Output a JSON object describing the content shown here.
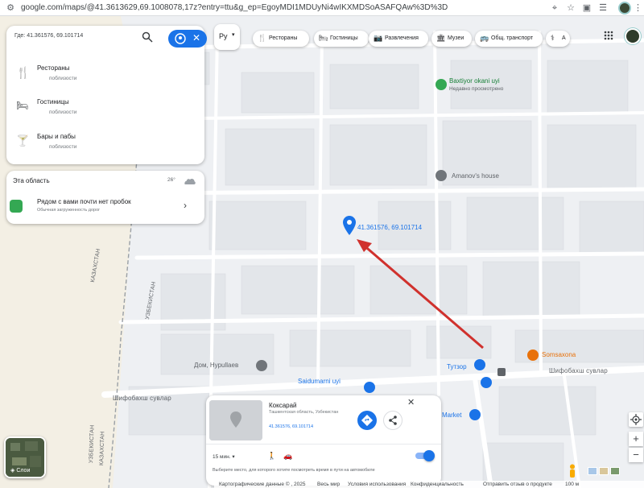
{
  "browser": {
    "url": "google.com/maps/@41.3613629,69.1008078,17z?entry=ttu&g_ep=EgoyMDI1MDUyNi4wIKXMDSoASAFQAw%3D%3D"
  },
  "search": {
    "value": "Где: 41.361576, 69.101714",
    "nearby": [
      {
        "title": "Рестораны",
        "subtitle": "поблизости",
        "icon": "restaurant-icon"
      },
      {
        "title": "Гостиницы",
        "subtitle": "поблизости",
        "icon": "hotel-icon"
      },
      {
        "title": "Бары и пабы",
        "subtitle": "поблизости",
        "icon": "bar-icon"
      }
    ]
  },
  "area": {
    "title": "Эта область",
    "temperature": "26°",
    "traffic_title": "Рядом с вами почти нет пробок",
    "traffic_subtitle": "Обычная загруженность дорог"
  },
  "language_button": "Ру",
  "chips": [
    {
      "label": "Рестораны",
      "icon": "fork-knife-icon"
    },
    {
      "label": "Гостиницы",
      "icon": "bed-icon"
    },
    {
      "label": "Развлечения",
      "icon": "camera-icon"
    },
    {
      "label": "Музеи",
      "icon": "museum-icon"
    },
    {
      "label": "Общ. транспорт",
      "icon": "bus-icon"
    },
    {
      "label": "А",
      "icon": "pharmacy-icon"
    }
  ],
  "map": {
    "pin_label": "41.361576, 69.101714",
    "pois": {
      "baxtiyor": "Baxtiyor okani uyi",
      "baxtiyor_sub": "Недавно просмотрено",
      "amanov": "Amanov's house",
      "somsaxona": "Somsaxona",
      "saidumarni": "Saidumarni uyi",
      "nurullaev": "Дом, Нурullaев",
      "tutzor": "Тутзор",
      "market": "Market"
    },
    "streets": {
      "shifobaxsh_right": "Шифобахш сувлар",
      "shifobaxsh_left": "Шифобахш сувлар",
      "kazakhstan_1": "КАЗАХСТАН",
      "uzbekistan_1": "УЗБЕКИСТАН",
      "uzbekistan_2": "УЗБЕКИСТАН",
      "kazakhstan_2": "КАЗАХСТАН"
    },
    "colors": {
      "pin": "#1a73e8",
      "arrow": "#d0312d",
      "poi_green": "#34a853",
      "poi_blue": "#1a73e8",
      "poi_orange": "#e8710a",
      "poi_gray": "#70757a"
    }
  },
  "place_card": {
    "name": "Коксарай",
    "region": "Ташкентская область, Узбекистан",
    "coords": "41.361576, 69.101714",
    "time_select": "15 мин.",
    "hint": "Выберите место, для которого хотите посмотреть время в пути на автомобиле"
  },
  "layers_label": "Слои",
  "footer": {
    "copyright": "Картографические данные © , 2025",
    "world": "Весь мир",
    "terms": "Условия использования",
    "privacy": "Конфиденциальность",
    "feedback": "Отправить отзыв о продукте",
    "scale": "100 м"
  }
}
